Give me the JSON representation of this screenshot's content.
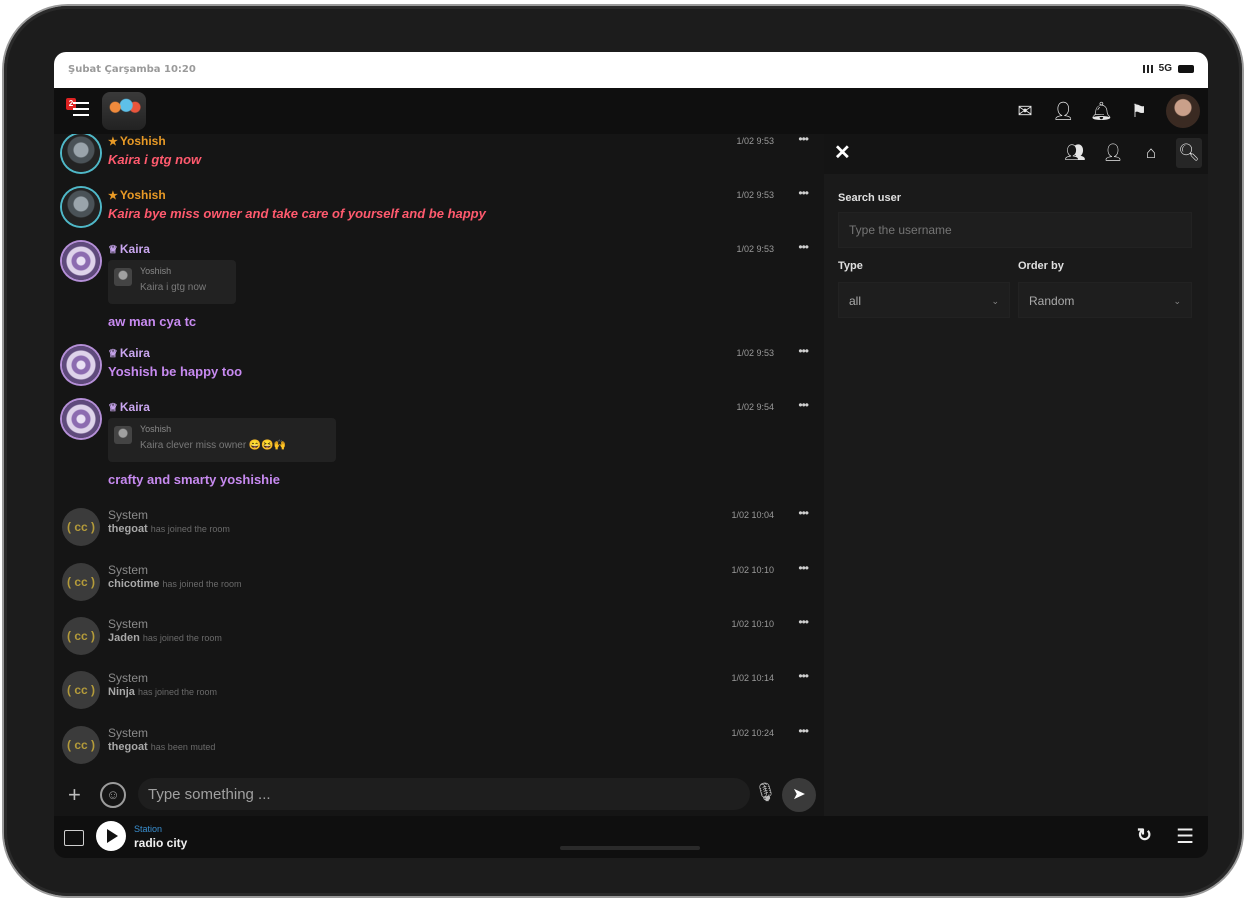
{
  "status_bar": {
    "time": "Şubat Çarşamba 10:20",
    "network": "5G"
  },
  "topbar": {
    "menu_badge": "2"
  },
  "messages": [
    {
      "user": "Yoshish",
      "time": "1/02 9:53",
      "text": "Kaira i gtg now"
    },
    {
      "user": "Yoshish",
      "time": "1/02 9:53",
      "text": "Kaira bye miss owner and take care of yourself and be happy"
    },
    {
      "user": "Kaira",
      "time": "1/02 9:53",
      "quote_user": "Yoshish",
      "quote_text": "Kaira i gtg now",
      "text": "aw man cya tc"
    },
    {
      "user": "Kaira",
      "time": "1/02 9:53",
      "text": "Yoshish be happy too"
    },
    {
      "user": "Kaira",
      "time": "1/02 9:54",
      "quote_user": "Yoshish",
      "quote_text": "Kaira clever miss owner 😄😆🙌",
      "text": "crafty and smarty yoshishie"
    }
  ],
  "system_messages": [
    {
      "user": "System",
      "time": "1/02 10:04",
      "name": "thegoat",
      "action": "has joined the room"
    },
    {
      "user": "System",
      "time": "1/02 10:10",
      "name": "chicotime",
      "action": "has joined the room"
    },
    {
      "user": "System",
      "time": "1/02 10:10",
      "name": "Jaden",
      "action": "has joined the room"
    },
    {
      "user": "System",
      "time": "1/02 10:14",
      "name": "Ninja",
      "action": "has joined the room"
    },
    {
      "user": "System",
      "time": "1/02 10:24",
      "name": "thegoat",
      "action": "has been muted"
    }
  ],
  "system_avatar": "( cc )",
  "composer": {
    "placeholder": "Type something ..."
  },
  "panel": {
    "search_label": "Search user",
    "search_placeholder": "Type the username",
    "type_label": "Type",
    "type_value": "all",
    "order_label": "Order by",
    "order_value": "Random"
  },
  "player": {
    "station_label": "Station",
    "station_name": "radio city"
  }
}
